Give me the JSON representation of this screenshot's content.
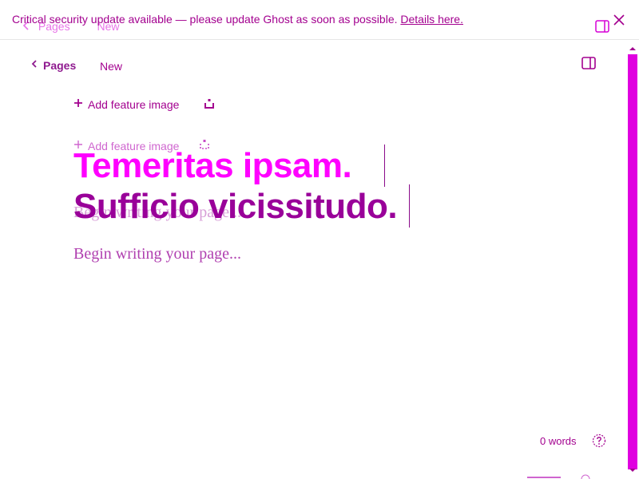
{
  "banner": {
    "message": "Critical security update available — please update Ghost as soon as possible.",
    "link_label": "Details here."
  },
  "header": {
    "breadcrumb_label": "Pages",
    "status": "New"
  },
  "editor": {
    "feature_image_label": "Add feature image",
    "title_line_1": "Temeritas ipsam.",
    "title_line_2": "Sufficio vicissitudo.",
    "body_placeholder": "Begin writing your page..."
  },
  "footer": {
    "word_count": "0 words"
  },
  "colors": {
    "accent": "#ff00ff",
    "title_secondary": "#990099",
    "text_primary": "#a3008f",
    "scrollbar": "#e000e0"
  },
  "icons": {
    "close": "close-icon",
    "back": "chevron-left-icon",
    "sidebar": "sidebar-toggle-icon",
    "plus": "plus-icon",
    "image": "image-icon",
    "help": "help-icon"
  }
}
